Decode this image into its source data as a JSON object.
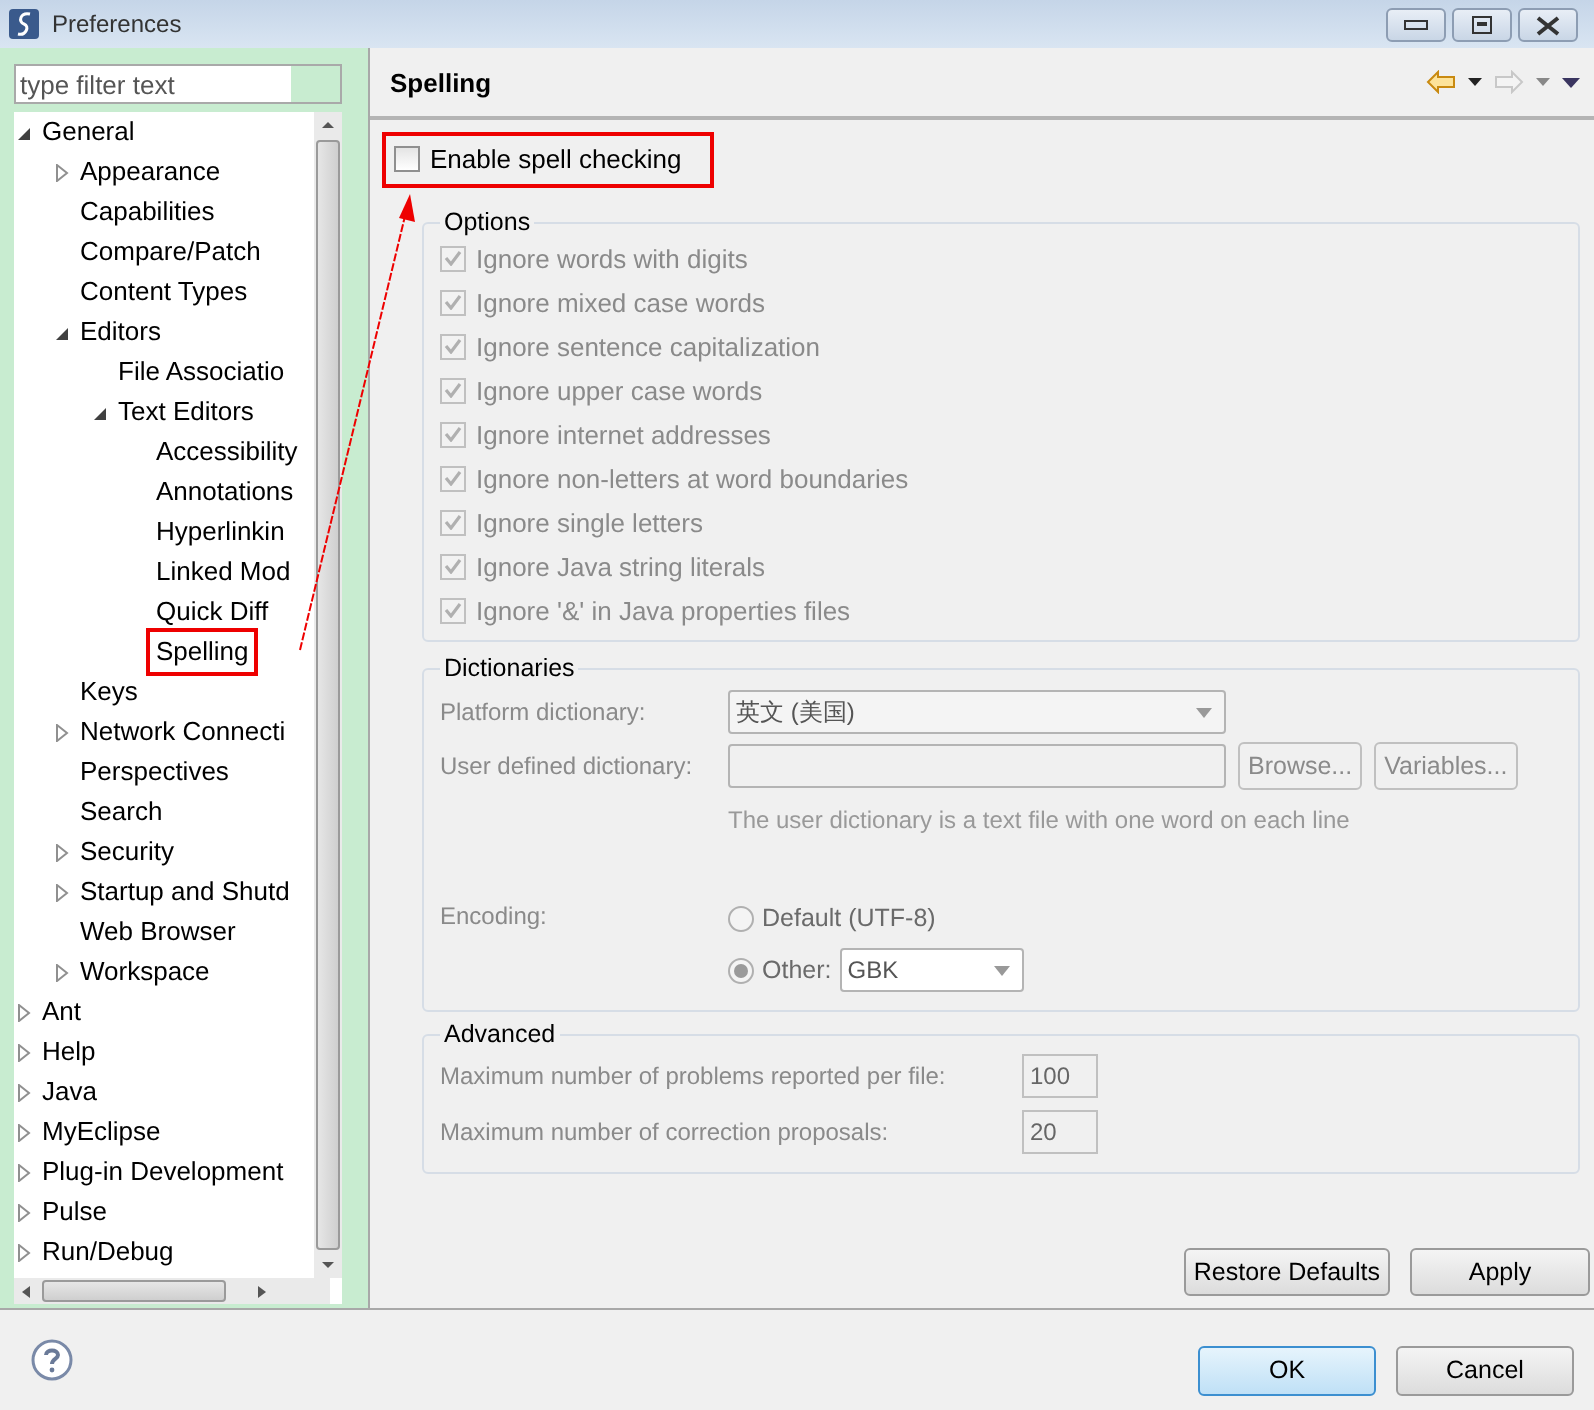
{
  "window": {
    "title": "Preferences"
  },
  "filter": {
    "placeholder": "type filter text"
  },
  "tree": [
    {
      "label": "General",
      "kind": "branch",
      "expanded": true,
      "annotated": false,
      "children": [
        {
          "label": "Appearance",
          "kind": "branch",
          "expanded": false,
          "annotated": false
        },
        {
          "label": "Capabilities",
          "kind": "leaf",
          "annotated": false
        },
        {
          "label": "Compare/Patch",
          "kind": "leaf",
          "annotated": false
        },
        {
          "label": "Content Types",
          "kind": "leaf",
          "annotated": false
        },
        {
          "label": "Editors",
          "kind": "branch",
          "expanded": true,
          "annotated": false,
          "children": [
            {
              "label": "File Associatio",
              "kind": "leaf",
              "annotated": false
            },
            {
              "label": "Text Editors",
              "kind": "branch",
              "expanded": true,
              "annotated": false,
              "children": [
                {
                  "label": "Accessibility",
                  "kind": "leaf",
                  "annotated": false
                },
                {
                  "label": "Annotations",
                  "kind": "leaf",
                  "annotated": false
                },
                {
                  "label": "Hyperlinkin",
                  "kind": "leaf",
                  "annotated": false
                },
                {
                  "label": "Linked Mod",
                  "kind": "leaf",
                  "annotated": false
                },
                {
                  "label": "Quick Diff",
                  "kind": "leaf",
                  "annotated": false
                },
                {
                  "label": "Spelling",
                  "kind": "leaf",
                  "annotated": true
                }
              ]
            }
          ]
        },
        {
          "label": "Keys",
          "kind": "leaf",
          "annotated": false
        },
        {
          "label": "Network Connecti",
          "kind": "branch",
          "expanded": false,
          "annotated": false
        },
        {
          "label": "Perspectives",
          "kind": "leaf",
          "annotated": false
        },
        {
          "label": "Search",
          "kind": "leaf",
          "annotated": false
        },
        {
          "label": "Security",
          "kind": "branch",
          "expanded": false,
          "annotated": false
        },
        {
          "label": "Startup and Shutd",
          "kind": "branch",
          "expanded": false,
          "annotated": false
        },
        {
          "label": "Web Browser",
          "kind": "leaf",
          "annotated": false
        },
        {
          "label": "Workspace",
          "kind": "branch",
          "expanded": false,
          "annotated": false
        }
      ]
    },
    {
      "label": "Ant",
      "kind": "branch",
      "expanded": false,
      "annotated": false
    },
    {
      "label": "Help",
      "kind": "branch",
      "expanded": false,
      "annotated": false
    },
    {
      "label": "Java",
      "kind": "branch",
      "expanded": false,
      "annotated": false
    },
    {
      "label": "MyEclipse",
      "kind": "branch",
      "expanded": false,
      "annotated": false
    },
    {
      "label": "Plug-in Development",
      "kind": "branch",
      "expanded": false,
      "annotated": false
    },
    {
      "label": "Pulse",
      "kind": "branch",
      "expanded": false,
      "annotated": false
    },
    {
      "label": "Run/Debug",
      "kind": "branch",
      "expanded": false,
      "annotated": false
    }
  ],
  "page": {
    "title": "Spelling",
    "enable": {
      "label": "Enable spell checking",
      "checked": false,
      "annotated": true
    },
    "options": {
      "title": "Options",
      "items": [
        {
          "label": "Ignore words with digits",
          "checked": true,
          "disabled": true
        },
        {
          "label": "Ignore mixed case words",
          "checked": true,
          "disabled": true
        },
        {
          "label": "Ignore sentence capitalization",
          "checked": true,
          "disabled": true
        },
        {
          "label": "Ignore upper case words",
          "checked": true,
          "disabled": true
        },
        {
          "label": "Ignore internet addresses",
          "checked": true,
          "disabled": true
        },
        {
          "label": "Ignore non-letters at word boundaries",
          "checked": true,
          "disabled": true
        },
        {
          "label": "Ignore single letters",
          "checked": true,
          "disabled": true
        },
        {
          "label": "Ignore Java string literals",
          "checked": true,
          "disabled": true
        },
        {
          "label": "Ignore '&' in Java properties files",
          "checked": true,
          "disabled": true
        }
      ]
    },
    "dictionaries": {
      "title": "Dictionaries",
      "platform_label": "Platform dictionary:",
      "platform_value": "英文 (美国)",
      "user_label": "User defined dictionary:",
      "browse": "Browse...",
      "variables": "Variables...",
      "hint": "The user dictionary is a text file with one word on each line",
      "encoding_label": "Encoding:",
      "encodings": [
        {
          "label": "Default (UTF-8)",
          "selected": false
        },
        {
          "label": "Other:",
          "selected": true
        }
      ],
      "other_value": "GBK"
    },
    "advanced": {
      "title": "Advanced",
      "fields": [
        {
          "label": "Maximum number of problems reported per file:",
          "value": "100"
        },
        {
          "label": "Maximum number of correction proposals:",
          "value": "20"
        }
      ]
    },
    "buttons": [
      "Restore Defaults",
      "Apply"
    ]
  },
  "footer": {
    "buttons": [
      {
        "label": "OK",
        "default": true
      },
      {
        "label": "Cancel",
        "default": false
      }
    ]
  }
}
